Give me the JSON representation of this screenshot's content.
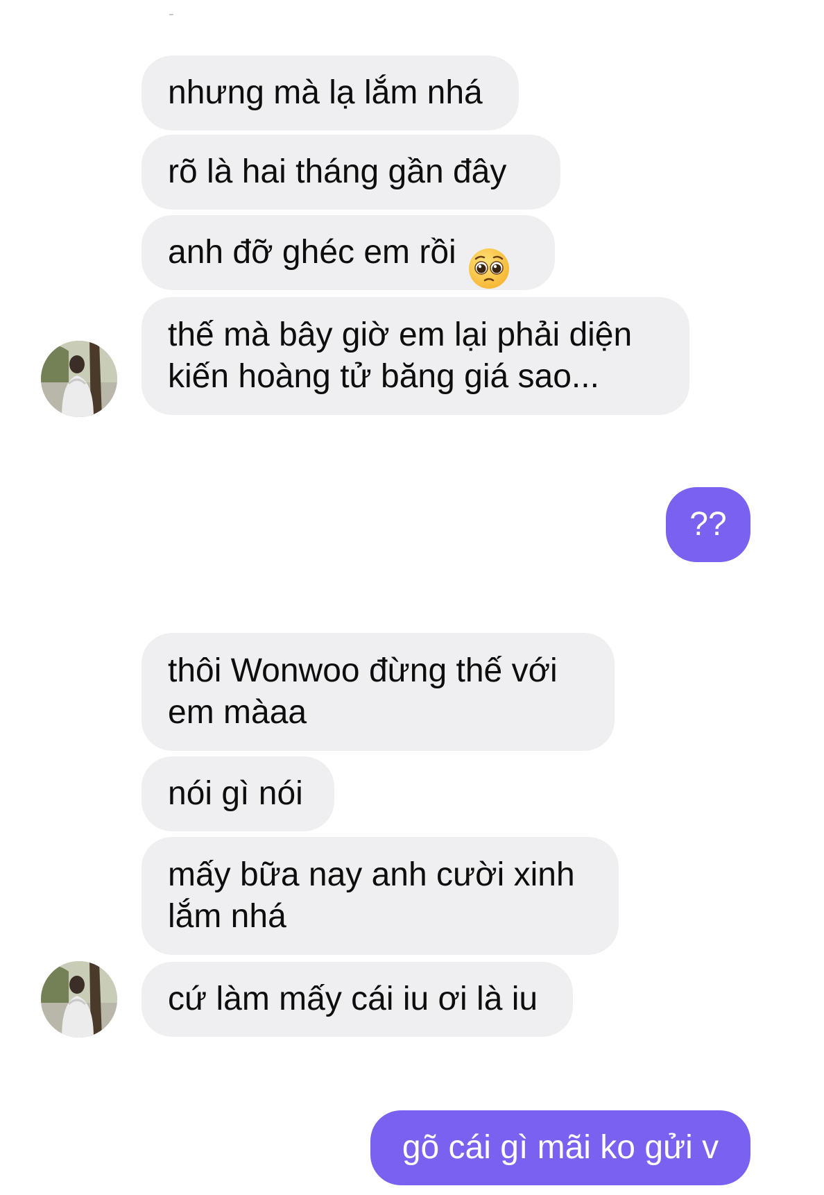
{
  "conversation": {
    "messages": [
      {
        "sender": "contact",
        "text": "nhưng mà lạ lắm nhá"
      },
      {
        "sender": "contact",
        "text": "rõ là hai tháng gần đây"
      },
      {
        "sender": "contact",
        "text": "anh đỡ ghéc em rồi",
        "emoji": "pleading-face-emoji"
      },
      {
        "sender": "contact",
        "text": "thế mà bây giờ em lại phải diện\nkiến hoàng tử băng giá sao..."
      },
      {
        "sender": "me",
        "text": "??"
      },
      {
        "sender": "contact",
        "text": "thôi Wonwoo đừng thế với\nem màaa"
      },
      {
        "sender": "contact",
        "text": "nói gì nói"
      },
      {
        "sender": "contact",
        "text": "mấy bữa nay anh cười xinh\nlắm nhá"
      },
      {
        "sender": "contact",
        "text": "cứ làm mấy cái iu ơi là iu"
      },
      {
        "sender": "me",
        "text": "gõ cái gì mãi ko gửi v"
      }
    ]
  },
  "colors": {
    "incoming_bubble": "#efeff1",
    "outgoing_bubble": "#7b61ef",
    "incoming_text": "#0d0d0d",
    "outgoing_text": "#ffffff"
  },
  "icons": {
    "avatar": "contact-avatar-photo",
    "emoji": "pleading-face-emoji"
  }
}
